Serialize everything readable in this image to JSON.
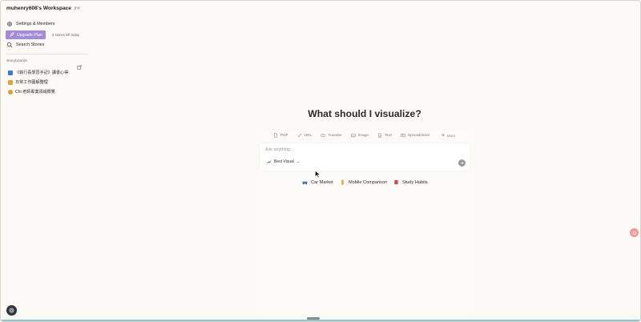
{
  "sidebar": {
    "workspace_title": "muhenry608's Workspace",
    "settings_label": "Settings & Members",
    "upgrade_label": "Upgrade Plan",
    "busy_text": "3 stories left today",
    "search_label": "Search Stories",
    "section_title": "Storyboards",
    "stories": [
      {
        "label": "《執行長學習手記》讀書心得",
        "icon_color": "#3b7bd8"
      },
      {
        "label": "日常工作圖解整理",
        "icon_color": "#e0a23a"
      },
      {
        "label": "Chi 老師專業領域概覽",
        "icon_color": "#d9a02c"
      }
    ]
  },
  "main": {
    "title": "What should I visualize?",
    "source_tabs": [
      "PDF",
      "URL",
      "Youtube",
      "Image",
      "Text",
      "Spreadsheet"
    ],
    "more_label": "More",
    "input_placeholder": "Ask anything...",
    "input_value": "",
    "visual_select": "Best Visual",
    "suggestions": [
      {
        "label": "Car Market",
        "icon": "car-icon"
      },
      {
        "label": "Mobile Comparison",
        "icon": "mobile-icon"
      },
      {
        "label": "Study Habits",
        "icon": "book-icon"
      }
    ]
  },
  "colors": {
    "accent": "#a48bd9",
    "background": "#fbf8f3",
    "help_bubble": "#ef9a9a"
  }
}
